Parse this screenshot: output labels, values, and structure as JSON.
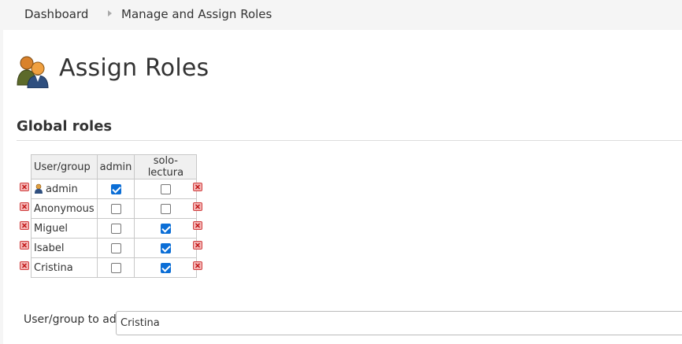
{
  "breadcrumb": {
    "items": [
      "Dashboard",
      "Manage and Assign Roles"
    ]
  },
  "page": {
    "title": "Assign Roles",
    "title_icon": "users-icon"
  },
  "global_roles": {
    "title": "Global roles",
    "columns": [
      "User/group",
      "admin",
      "solo-lectura"
    ],
    "rows": [
      {
        "name": "admin",
        "icon": "user-icon",
        "admin": true,
        "solo_lectura": false
      },
      {
        "name": "Anonymous",
        "admin": false,
        "solo_lectura": false
      },
      {
        "name": "Miguel",
        "admin": false,
        "solo_lectura": true
      },
      {
        "name": "Isabel",
        "admin": false,
        "solo_lectura": true
      },
      {
        "name": "Cristina",
        "admin": false,
        "solo_lectura": true
      }
    ],
    "delete_icon": "delete-icon"
  },
  "add_user": {
    "label": "User/group to add",
    "value": "Cristina"
  },
  "colors": {
    "checkbox_checked": "#0b6ed6",
    "delete_icon": "#e35a5a",
    "breadcrumb_bg": "#f5f5f5"
  }
}
